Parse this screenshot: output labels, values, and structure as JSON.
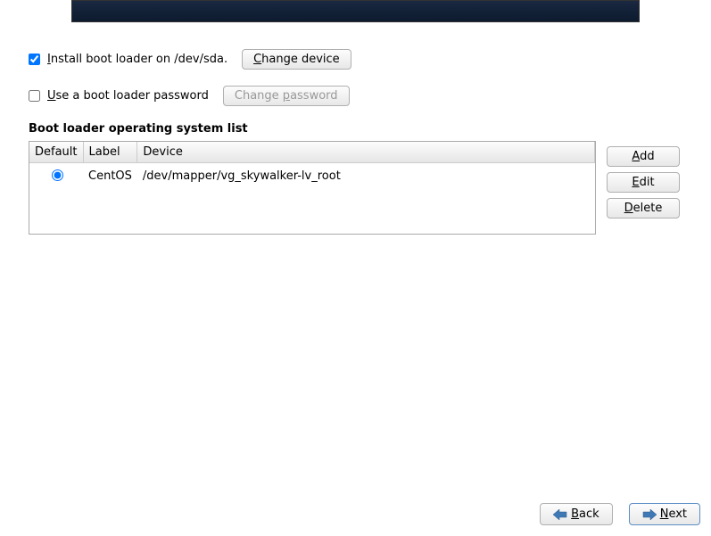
{
  "options": {
    "install_boot_loader": {
      "checked": true,
      "label_pre": "I",
      "label_post": "nstall boot loader on /dev/sda.",
      "change_device_pre": "C",
      "change_device_post": "hange device"
    },
    "use_password": {
      "checked": false,
      "label_pre": "U",
      "label_post": "se a boot loader password",
      "change_password_pre": "Change ",
      "change_password_mid": "p",
      "change_password_post": "assword"
    }
  },
  "section_title": "Boot loader operating system list",
  "table": {
    "headers": {
      "default": "Default",
      "label": "Label",
      "device": "Device"
    },
    "rows": [
      {
        "default": true,
        "label": "CentOS",
        "device": "/dev/mapper/vg_skywalker-lv_root"
      }
    ]
  },
  "side_buttons": {
    "add_pre": "A",
    "add_post": "dd",
    "edit_pre": "E",
    "edit_post": "dit",
    "delete_pre": "D",
    "delete_post": "elete"
  },
  "footer": {
    "back_pre": "B",
    "back_post": "ack",
    "next_pre": "N",
    "next_post": "ext"
  }
}
